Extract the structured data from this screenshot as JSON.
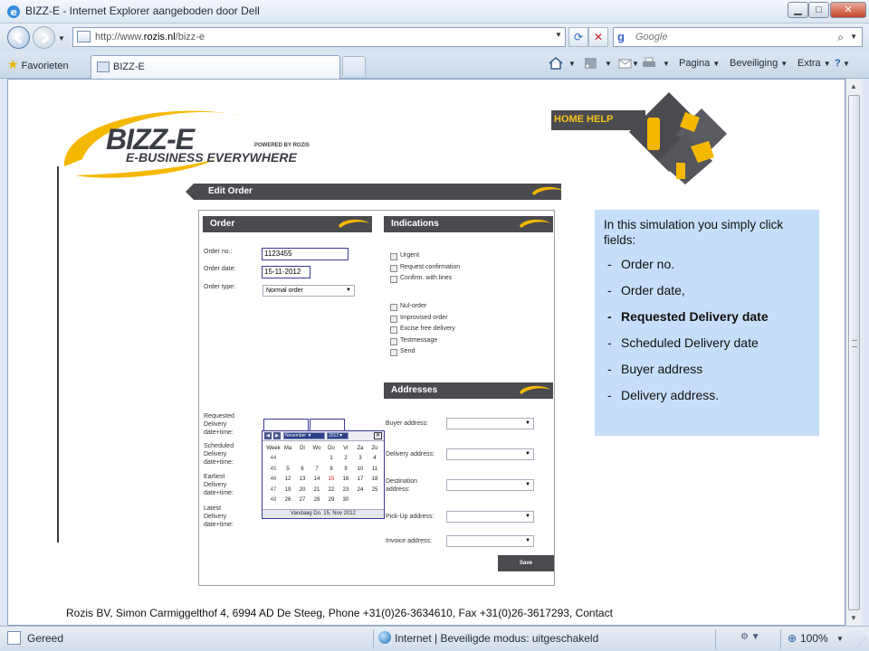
{
  "window": {
    "title": "BIZZ-E - Internet Explorer aangeboden door Dell"
  },
  "address_bar": {
    "url_prefix": "http://www.",
    "url_host": "rozis.nl",
    "url_path": "/bizz-e"
  },
  "search": {
    "placeholder": "Google"
  },
  "tabs": {
    "favorites_label": "Favorieten",
    "active_tab_title": "BIZZ-E"
  },
  "command_bar": {
    "page_label": "Pagina",
    "safety_label": "Beveiliging",
    "extra_label": "Extra"
  },
  "logo": {
    "main": "BIZZ-E",
    "tagline": "E-BUSINESS EVERYWHERE",
    "powered": "POWERED BY ROZIS"
  },
  "header": {
    "home_help": "HOME HELP"
  },
  "edit_order": {
    "title": "Edit Order"
  },
  "order": {
    "section_title": "Order",
    "order_no_label": "Order no.:",
    "order_no_value": "1123455",
    "order_date_label": "Order date:",
    "order_date_value": "15-11-2012",
    "order_type_label": "Order type:",
    "order_type_value": "Normal order"
  },
  "indications": {
    "section_title": "Indications",
    "group1": [
      "Urgent",
      "Request confirmation",
      "Confirm. with lines"
    ],
    "group2": [
      "Nul-order",
      "Improvised order",
      "Excise free delivery",
      "Testmessage",
      "Send"
    ]
  },
  "addresses": {
    "section_title": "Addresses",
    "buyer": "Buyer address:",
    "delivery": "Delivery address:",
    "destination": "Destination address:",
    "pickup": "Pick-Up address:",
    "invoice": "Invoice address:"
  },
  "dates": {
    "requested": "Requested Delivery date+time:",
    "scheduled": "Scheduled Delivery date+time:",
    "earliest": "Earliest Delivery date+time:",
    "latest": "Latest Delivery date+time:"
  },
  "calendar": {
    "month": "November",
    "year": "2012",
    "close": "✕",
    "headers": [
      "Week",
      "Ma",
      "Di",
      "Wo",
      "Do",
      "Vr",
      "Za",
      "Zo"
    ],
    "rows": [
      [
        "44",
        "",
        "",
        "",
        "1",
        "2",
        "3",
        "4"
      ],
      [
        "45",
        "5",
        "6",
        "7",
        "8",
        "9",
        "10",
        "11"
      ],
      [
        "46",
        "12",
        "13",
        "14",
        "15",
        "16",
        "17",
        "18"
      ],
      [
        "47",
        "19",
        "20",
        "21",
        "22",
        "23",
        "24",
        "25"
      ],
      [
        "48",
        "26",
        "27",
        "28",
        "29",
        "30",
        "",
        ""
      ]
    ],
    "today_cell": "15",
    "footer": "Vandaag Do. 15. Nov 2012"
  },
  "save_button": "Save",
  "info_box": {
    "intro": "In this simulation you simply click fields:",
    "items": [
      {
        "text": "Order no.",
        "bold": false
      },
      {
        "text": "Order date,",
        "bold": false
      },
      {
        "text": "Requested Delivery date",
        "bold": true
      },
      {
        "text": "Scheduled Delivery date",
        "bold": false
      },
      {
        "text": "Buyer address",
        "bold": false
      },
      {
        "text": "Delivery address.",
        "bold": false
      }
    ]
  },
  "footer": {
    "text": "Rozis BV, Simon Carmiggelthof 4, 6994 AD De Steeg, Phone +31(0)26-3634610, Fax +31(0)26-3617293, Contact"
  },
  "status_bar": {
    "status": "Gereed",
    "zone": "Internet | Beveiligde modus: uitgeschakeld",
    "zoom": "100%"
  },
  "colors": {
    "brand_yellow": "#f5b800",
    "dark_bar": "#4a4b4f",
    "info_bg": "#c6defa"
  }
}
